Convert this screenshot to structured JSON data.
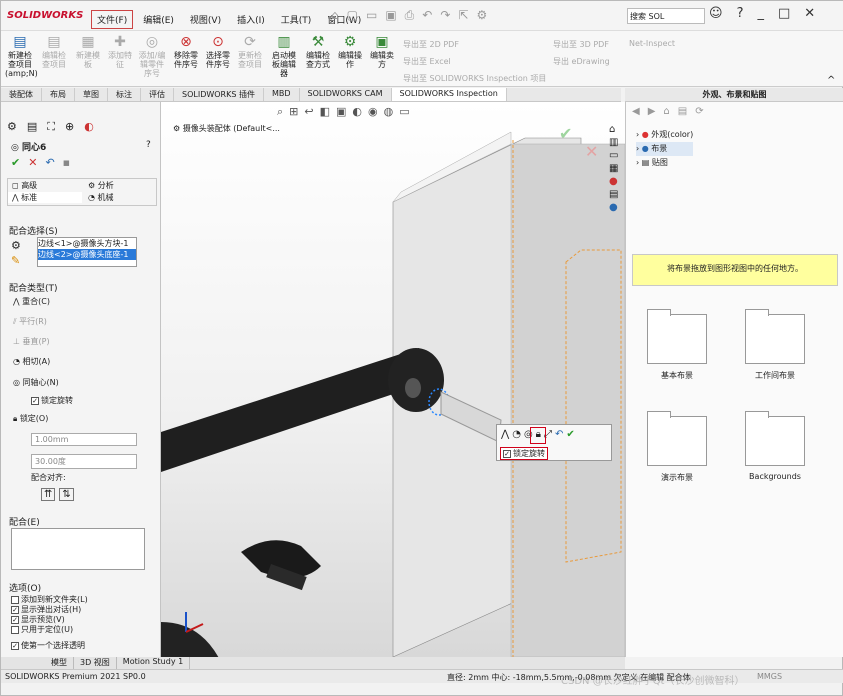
{
  "app": {
    "logo": "SOLIDWORKS",
    "search_placeholder": "搜索 SOL",
    "status_left": "SOLIDWORKS Premium 2021 SP0.0",
    "status_mid": "直径: 2mm 中心: -18mm,5.5mm,-0.08mm 欠定义 在编辑 配合体",
    "status_units": "MMGS"
  },
  "menu": [
    "文件(F)",
    "编辑(E)",
    "视图(V)",
    "插入(I)",
    "工具(T)",
    "窗口(W)"
  ],
  "ribbon": {
    "buttons": [
      "新建检查项目(amp;N)",
      "编辑检查项目",
      "新建模板",
      "添加特征",
      "添加/编辑零件序号",
      "移除零件序号",
      "选择零件序号",
      "更新检查项目",
      "启动模板编辑器",
      "编辑检查方式",
      "编辑操作",
      "编辑卖方"
    ],
    "exports": [
      "导出至 2D PDF",
      "导出至 3D PDF",
      "Net-Inspect",
      "导出至 Excel",
      "导出 eDrawing",
      "导出至 SOLIDWORKS Inspection 项目"
    ]
  },
  "tabs": [
    "装配体",
    "布局",
    "草图",
    "标注",
    "评估",
    "SOLIDWORKS 插件",
    "MBD",
    "SOLIDWORKS CAM",
    "SOLIDWORKS Inspection"
  ],
  "mate": {
    "title": "同心6",
    "tab_advanced": "高级",
    "tab_analysis": "分析",
    "tab_standard": "标准",
    "tab_mechanical": "机械",
    "selections_header": "配合选择(S)",
    "sel1": "边线<1>@摄像头方块-1",
    "sel2": "边线<2>@摄像头底座-1",
    "types_header": "配合类型(T)",
    "coincident": "重合(C)",
    "parallel": "平行(R)",
    "perpendicular": "垂直(P)",
    "tangent": "相切(A)",
    "concentric": "同轴心(N)",
    "lock_rotation": "锁定旋转",
    "lock": "锁定(O)",
    "distance": "1.00mm",
    "angle": "30.00度",
    "alignment": "配合对齐:",
    "mates_header": "配合(E)",
    "options_header": "选项(O)",
    "opt1": "添加到新文件夹(L)",
    "opt2": "显示弹出对话(H)",
    "opt3": "显示预览(V)",
    "opt4": "只用于定位(U)",
    "opt5": "使第一个选择透明"
  },
  "graphics": {
    "breadcrumb": "摄像头装配体 (Default<...",
    "popup_lock": "锁定旋转"
  },
  "taskpane": {
    "title": "外观、布景和贴图",
    "tree": [
      "外观(color)",
      "布景",
      "贴图"
    ],
    "tip": "将布景拖放到图形视图中的任何地方。",
    "folders": [
      "基本布景",
      "工作间布景",
      "演示布景",
      "Backgrounds"
    ]
  },
  "bottom_tabs": [
    "模型",
    "3D 视图",
    "Motion Study 1"
  ],
  "watermark": "CSDN @长沙红胖子Qt（长沙创微智科）"
}
